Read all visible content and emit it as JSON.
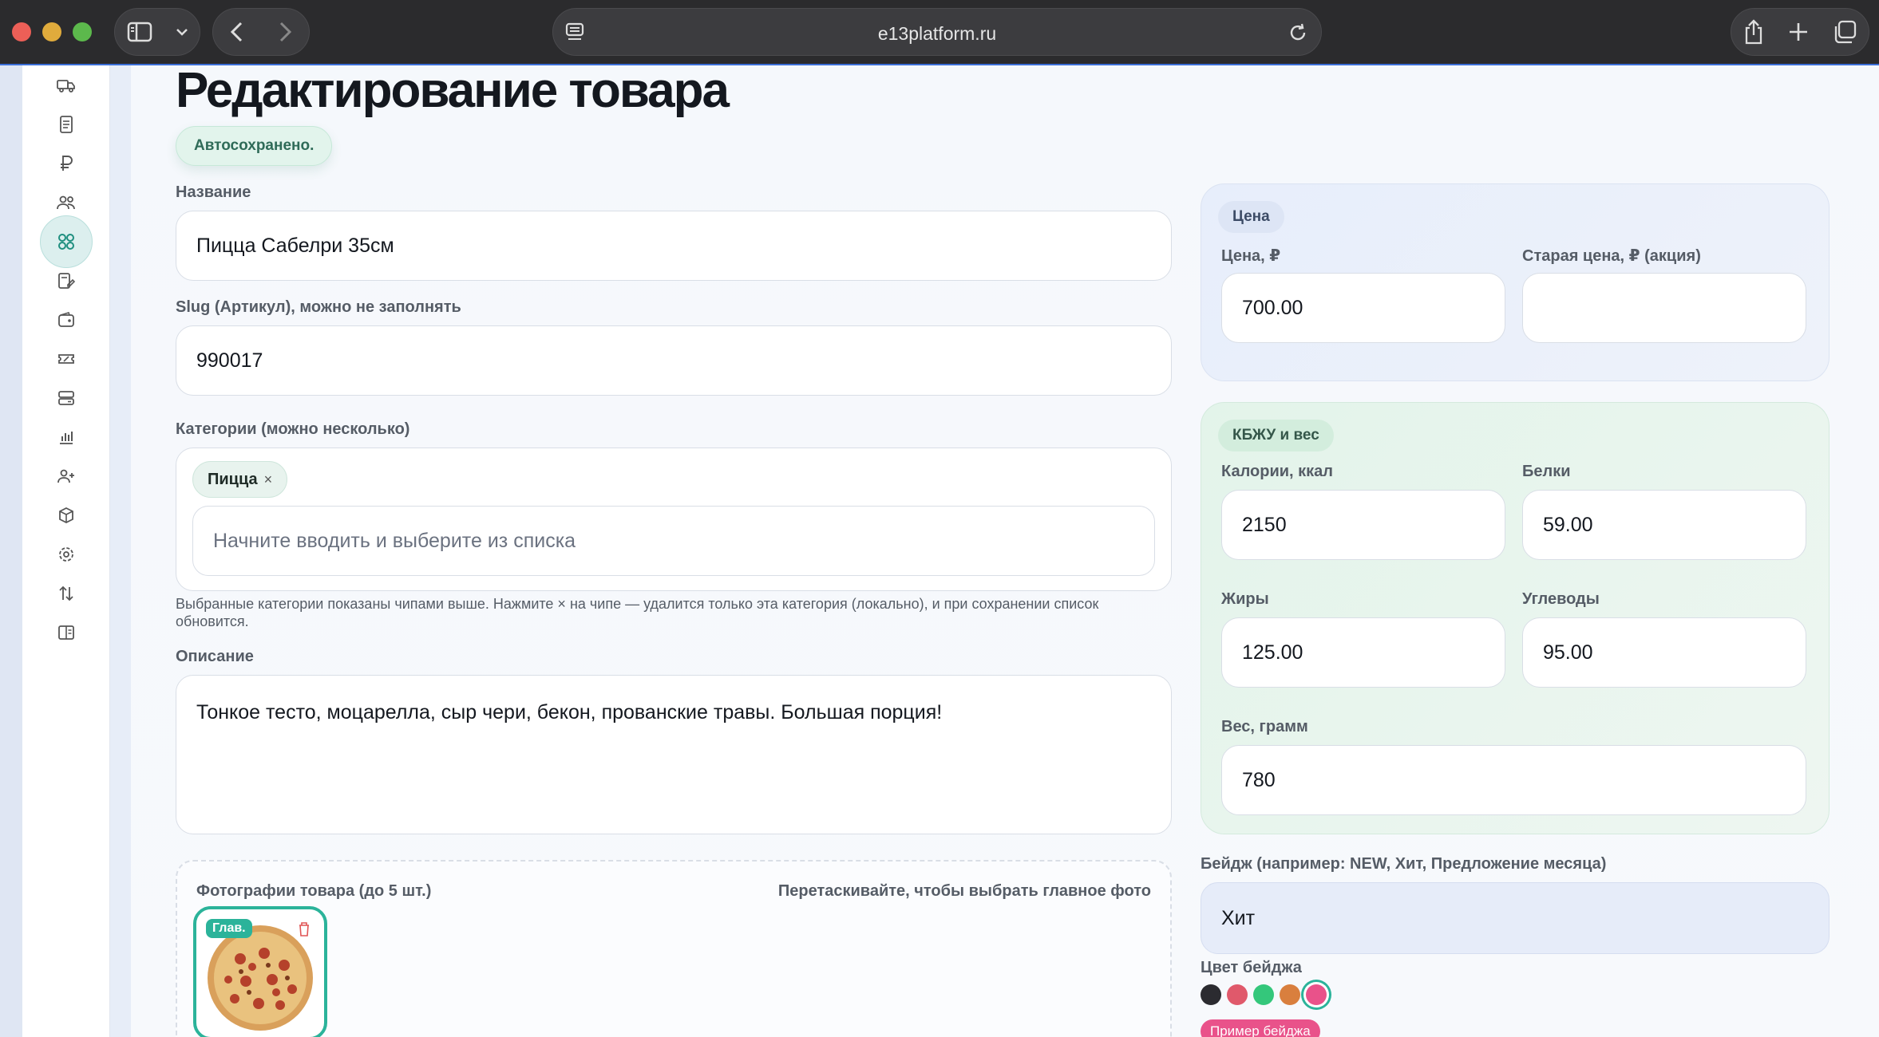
{
  "browser": {
    "url": "e13platform.ru"
  },
  "sidebar": {
    "items": [
      {
        "icon": "truck-icon"
      },
      {
        "icon": "document-icon"
      },
      {
        "icon": "ruble-icon"
      },
      {
        "icon": "users-icon"
      },
      {
        "icon": "grid-icon",
        "active": true
      },
      {
        "icon": "tag-edit-icon"
      },
      {
        "icon": "wallet-icon"
      },
      {
        "icon": "ticket-icon"
      },
      {
        "icon": "server-icon"
      },
      {
        "icon": "bar-chart-icon"
      },
      {
        "icon": "user-plus-icon"
      },
      {
        "icon": "box-icon"
      },
      {
        "icon": "settings-icon"
      },
      {
        "icon": "sort-arrows-icon"
      },
      {
        "icon": "book-icon"
      }
    ]
  },
  "page": {
    "title": "Редактирование товара",
    "autosave": "Автосохранено."
  },
  "form": {
    "name_label": "Название",
    "name_value": "Пицца Сабелри 35см",
    "slug_label": "Slug (Артикул), можно не заполнять",
    "slug_value": "990017",
    "categories_label": "Категории (можно несколько)",
    "category_chip": "Пицца",
    "category_chip_remove": "×",
    "categories_placeholder": "Начните вводить и выберите из списка",
    "categories_hint": "Выбранные категории показаны чипами выше. Нажмите × на чипе — удалится только эта категория (локально), и при сохранении список обновится.",
    "description_label": "Описание",
    "description_value": "Тонкое тесто, моцарелла, сыр чери, бекон, прованские травы. Большая порция!",
    "photos_title": "Фотографии товара (до 5 шт.)",
    "photos_hint": "Перетаскивайте, чтобы выбрать главное фото",
    "photo_main_badge": "Глав."
  },
  "price": {
    "heading": "Цена",
    "price_label": "Цена, ₽",
    "price_value": "700.00",
    "old_price_label": "Старая цена, ₽ (акция)",
    "old_price_value": ""
  },
  "kbju": {
    "heading": "КБЖУ и вес",
    "calories_label": "Калории, ккал",
    "calories_value": "2150",
    "protein_label": "Белки",
    "protein_value": "59.00",
    "fat_label": "Жиры",
    "fat_value": "125.00",
    "carbs_label": "Углеводы",
    "carbs_value": "95.00",
    "weight_label": "Вес, грамм",
    "weight_value": "780"
  },
  "badge": {
    "label": "Бейдж (например: NEW, Хит, Предложение месяца)",
    "value": "Хит",
    "color_label": "Цвет бейджа",
    "colors": [
      "#2b2b30",
      "#e0596b",
      "#34c77b",
      "#d97f3e",
      "#e9528a"
    ],
    "selected_color": "#e9528a",
    "preview": "Пример бейджа"
  }
}
